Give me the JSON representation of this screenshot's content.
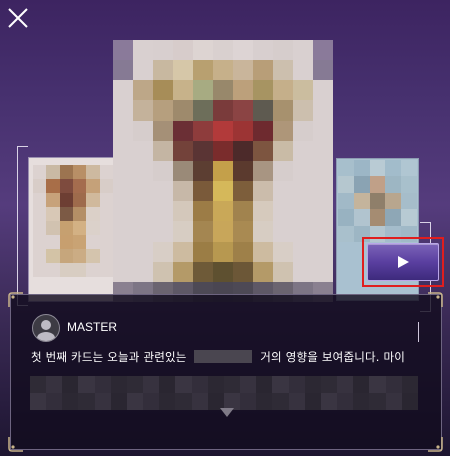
{
  "dialog": {
    "speaker": "MASTER",
    "text_part1": "첫 번째 카드는 오늘과 관련있는",
    "text_part2": "거의 영향을 보여줍니다. 마이"
  },
  "colors": {
    "background_top": "#3d2461",
    "play_button": "#5a3fa0",
    "highlight_border": "#e01e1e"
  },
  "icons": {
    "close": "close-icon",
    "play": "play-icon",
    "scroll_down": "triangle-down-icon",
    "avatar": "user-avatar"
  }
}
